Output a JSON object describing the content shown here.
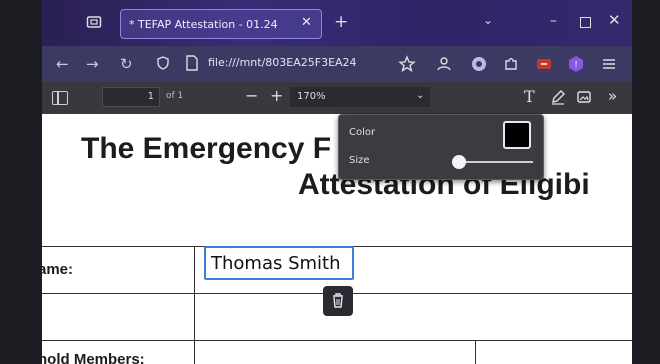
{
  "browser": {
    "tab": {
      "title": "* TEFAP Attestation - 01.24",
      "close": "✕"
    },
    "new_tab": "+",
    "list_all_tabs": "⌄",
    "window_controls": {
      "minimize": "–",
      "close": "✕"
    },
    "nav": {
      "back": "←",
      "forward": "→",
      "reload": "↻"
    },
    "url": "file:///mnt/803EA25F3EA24"
  },
  "pdf_toolbar": {
    "page_number": "1",
    "page_count": "of 1",
    "zoom_out": "−",
    "zoom_in": "+",
    "zoom_value": "170%",
    "zoom_caret": "⌄",
    "text_tool": "T",
    "more": "»"
  },
  "document": {
    "title_line1": "The Emergency F     ance P",
    "title_line2": "Attestation of Eligibi",
    "row_label_name": "ame:",
    "row_label_members": "hold Members:",
    "name_field_value": "Thomas Smith"
  },
  "annotation_popup": {
    "color_label": "Color",
    "size_label": "Size",
    "color_value": "#000000",
    "size_level": 0
  },
  "colors": {
    "accent_tab_border": "#8b86d8",
    "field_focus": "#3a7fd8"
  }
}
